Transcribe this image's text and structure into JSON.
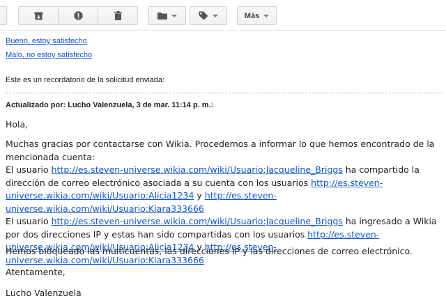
{
  "toolbar": {
    "archive_icon": "archive-icon",
    "spam_icon": "report-spam-icon",
    "delete_icon": "trash-icon",
    "folder_icon": "folder-icon",
    "label_icon": "tag-icon",
    "more_label": "Más"
  },
  "survey": {
    "good": "Bueno, estoy satisfecho",
    "bad": "Malo, no estoy satisfecho"
  },
  "reminder": "Este es un recordatorio de la solicitud enviada:",
  "update": {
    "author_line": "Actualizado por: Lucho Valenzuela, 3 de mar. 11:14 p. m.:"
  },
  "message": {
    "greeting": "Hola,",
    "intro": "Muchas gracias por contactarse con Wikia. Procedemos a informar lo que hemos encontrado de la mencionada cuenta:",
    "p1_prefix": "El usuario",
    "p1_link1": "http://es.steven-universe.wikia.com/wiki/Usuario:Jacqueline_Briggs",
    "p1_text1": "ha compartido la dirección de correo electrónico asociada a su cuenta con los usuarios",
    "p1_link2a": "http://es.steven-universe.wikia.com/wiki/Usuario:",
    "p1_link2b": "Alicia1234",
    "p1_and": "y",
    "p1_link3": "http://es.steven-universe.wikia.com/wiki/Usuario:Kiara333666",
    "p2_prefix": "El usuario",
    "p2_link1": "http://es.steven-universe.wikia.com/wiki/Usuario:Jacqueline_Briggs",
    "p2_text1": "ha ingresado a Wikia por dos direcciones IP y estas han sido compartidas con los usuarios",
    "p2_link2a": "http://es.steven-universe.wikia.com/wiki/Usuario:",
    "p2_link2b": "Alicia1234",
    "p2_and": "y",
    "p2_link3": "http://es.steven-universe.wikia.com/wiki/Usuario:Kiara333666",
    "blocked": "Hemos bloqueado las multicuentas, las direcciones IP y las direcciones de correo electrónico.",
    "closing": "Atentamente,",
    "signature": "Lucho Valenzuela"
  }
}
